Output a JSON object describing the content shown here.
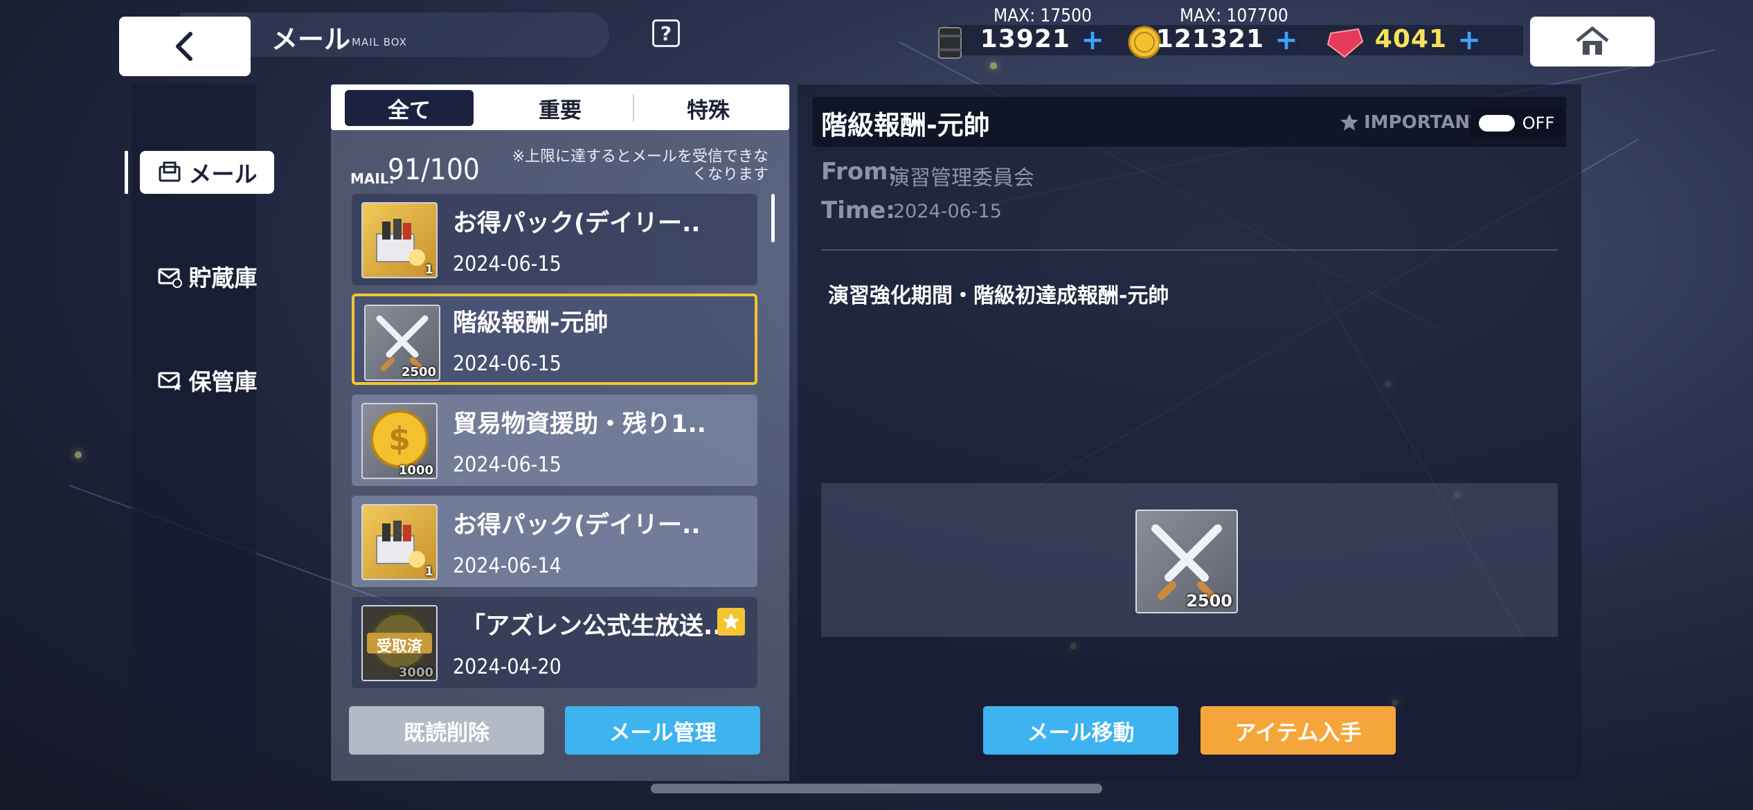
{
  "header": {
    "title": "メール",
    "subtitle": "MAIL BOX",
    "help_label": "?"
  },
  "resources": [
    {
      "name": "oil",
      "max_label": "",
      "amount": "13921",
      "icon": "oil-barrel-icon"
    },
    {
      "name": "oil-max",
      "max_label": "MAX: 17500"
    },
    {
      "name": "coin",
      "max_label": "MAX: 107700",
      "amount": "121321",
      "icon": "gold-coin-icon"
    },
    {
      "name": "gem",
      "max_label": "",
      "amount": "4041",
      "icon": "red-gem-icon"
    }
  ],
  "nav": {
    "items": [
      {
        "label": "メール",
        "icon": "mail-tray-icon",
        "active": true
      },
      {
        "label": "貯蔵庫",
        "icon": "mail-storage-icon",
        "active": false
      },
      {
        "label": "保管庫",
        "icon": "mail-archive-icon",
        "active": false
      }
    ]
  },
  "tabs": [
    {
      "label": "全て",
      "active": true
    },
    {
      "label": "重要",
      "active": false
    },
    {
      "label": "特殊",
      "active": false
    }
  ],
  "mailbox": {
    "count_label": "MAIL:",
    "count": "91/100",
    "limit_note_1": "※上限に達するとメールを受信できな",
    "limit_note_2": "くなります"
  },
  "mails": [
    {
      "subject": "お得パック(デイリー..",
      "date": "2024-06-15",
      "thumb": "daily-pack-icon",
      "qty": "1",
      "state": "read"
    },
    {
      "subject": "階級報酬-元帥",
      "date": "2024-06-15",
      "thumb": "crossed-swords-icon",
      "qty": "2500",
      "state": "selected"
    },
    {
      "subject": "貿易物資援助・残り1..",
      "date": "2024-06-15",
      "thumb": "gold-coin-icon",
      "qty": "1000",
      "state": "unread"
    },
    {
      "subject": "お得パック(デイリー..",
      "date": "2024-06-14",
      "thumb": "daily-pack-icon",
      "qty": "1",
      "state": "unread"
    },
    {
      "subject": "「アズレン公式生放送..",
      "date": "2024-04-20",
      "thumb": "gold-coin-icon",
      "qty": "3000",
      "state": "read",
      "claimed_label": "受取済",
      "starred": true
    }
  ],
  "list_buttons": {
    "delete_read": "既読削除",
    "manage": "メール管理"
  },
  "detail": {
    "title": "階級報酬-元帥",
    "important_label": "IMPORTANT",
    "toggle_state": "OFF",
    "from_label": "From:",
    "from_value": "演習管理委員会",
    "time_label": "Time:",
    "time_value": "2024-06-15",
    "body": "演習強化期間・階級初達成報酬-元帥",
    "attachment_qty": "2500",
    "attachment_icon": "crossed-swords-icon",
    "move_button": "メール移動",
    "collect_button": "アイテム入手"
  },
  "colors": {
    "accent_blue": "#3db3f0",
    "accent_orange": "#f5a63a",
    "selected_border": "#f5c531",
    "gem_amount": "#f7e25a"
  }
}
